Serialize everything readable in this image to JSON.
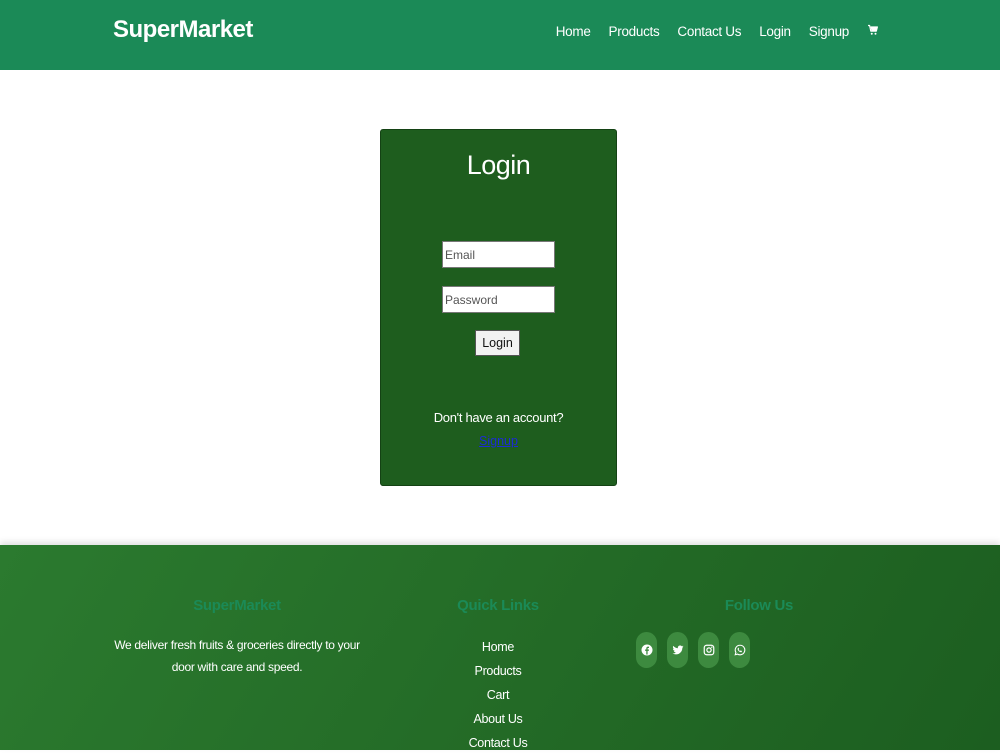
{
  "header": {
    "brand": "SuperMarket",
    "nav": {
      "home": "Home",
      "products": "Products",
      "contact": "Contact Us",
      "login": "Login",
      "signup": "Signup"
    },
    "cart_icon": "cart-icon",
    "background_color": "#1b8a57"
  },
  "login_form": {
    "title": "Login",
    "email_placeholder": "Email",
    "email_value": "",
    "password_placeholder": "Password",
    "password_value": "",
    "submit_label": "Login",
    "no_account_text": "Don't have an account?",
    "signup_link": "Signup",
    "card_color": "#1e5d1e"
  },
  "footer": {
    "about": {
      "heading": "SuperMarket",
      "text": "We deliver fresh fruits & groceries directly to your door with care and speed."
    },
    "quick_links": {
      "heading": "Quick Links",
      "items": [
        "Home",
        "Products",
        "Cart",
        "About Us",
        "Contact Us"
      ]
    },
    "follow": {
      "heading": "Follow Us",
      "icons": [
        "facebook-icon",
        "twitter-icon",
        "instagram-icon",
        "whatsapp-icon"
      ]
    },
    "heading_color": "#1b8a57"
  }
}
